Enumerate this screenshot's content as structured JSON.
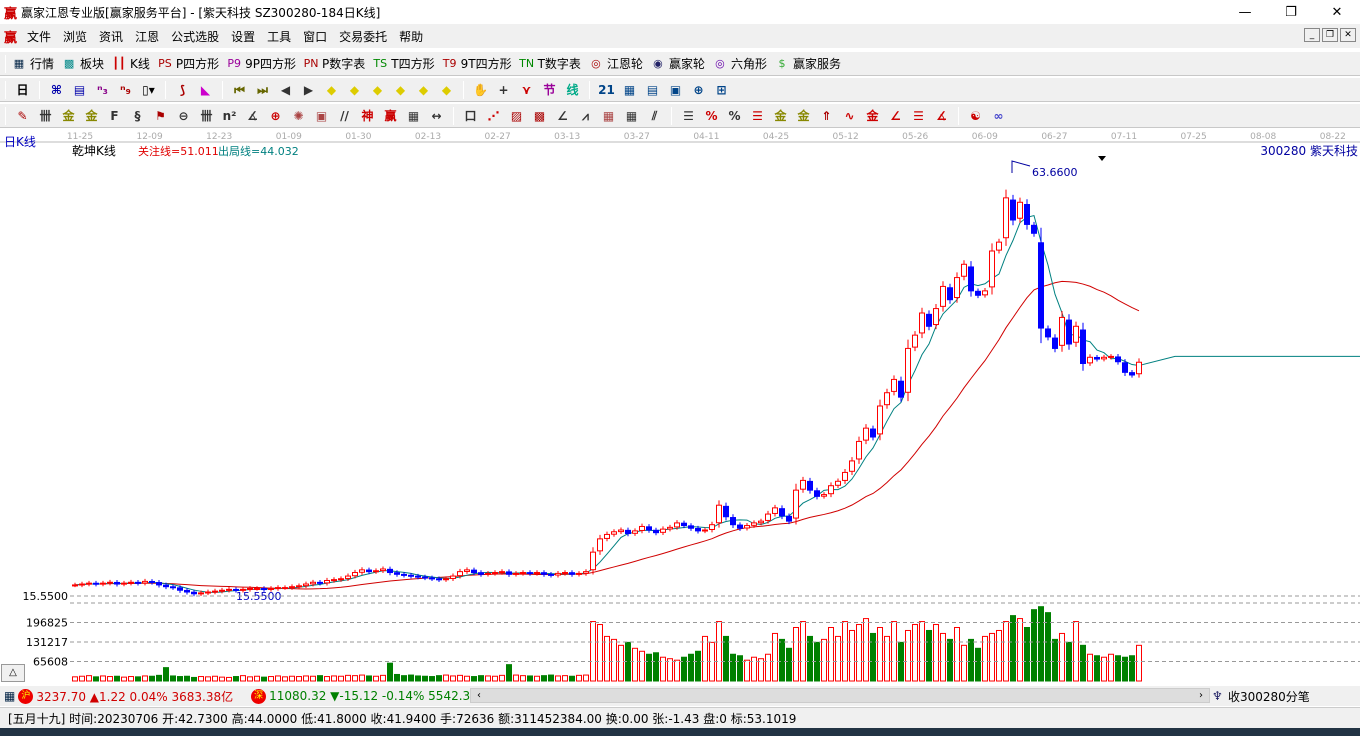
{
  "window": {
    "logo": "赢",
    "title": "赢家江恩专业版[赢家服务平台] - [紫天科技  SZ300280-184日K线]",
    "minimize": "—",
    "restore": "❐",
    "close": "✕"
  },
  "menu": {
    "logo": "赢",
    "items": [
      "文件",
      "浏览",
      "资讯",
      "江恩",
      "公式选股",
      "设置",
      "工具",
      "窗口",
      "交易委托",
      "帮助"
    ],
    "mdi": [
      "_",
      "❐",
      "✕"
    ]
  },
  "toolbar1": [
    {
      "icon": "quote-table-icon",
      "glyph": "▦",
      "label": "行情",
      "color": "#024"
    },
    {
      "icon": "sector-icon",
      "glyph": "▩",
      "label": "板块",
      "color": "#088"
    },
    {
      "icon": "kline-icon",
      "glyph": "┃┃",
      "label": "K线",
      "color": "#c00"
    },
    {
      "icon": "ps-icon",
      "glyph": "PS",
      "label": "P四方形",
      "color": "#a00"
    },
    {
      "icon": "p9-icon",
      "glyph": "P9",
      "label": "9P四方形",
      "color": "#909"
    },
    {
      "icon": "pn-icon",
      "glyph": "PN",
      "label": "P数字表",
      "color": "#a00"
    },
    {
      "icon": "ts-icon",
      "glyph": "TS",
      "label": "T四方形",
      "color": "#080"
    },
    {
      "icon": "t9-icon",
      "glyph": "T9",
      "label": "9T四方形",
      "color": "#a00"
    },
    {
      "icon": "tn-icon",
      "glyph": "TN",
      "label": "T数字表",
      "color": "#080"
    },
    {
      "icon": "gann-wheel-icon",
      "glyph": "◎",
      "label": "江恩轮",
      "color": "#a00"
    },
    {
      "icon": "big-wheel-icon",
      "glyph": "◉",
      "label": "赢家轮",
      "color": "#226"
    },
    {
      "icon": "hexagon-icon",
      "glyph": "◎",
      "label": "六角形",
      "color": "#60a"
    },
    {
      "icon": "dollar-icon",
      "glyph": "$",
      "label": "赢家服务",
      "color": "#3a3"
    }
  ],
  "toolbar2": [
    [
      "day-period-icon",
      "日▾",
      "#000"
    ],
    [
      "sep"
    ],
    [
      "chart-type-icon",
      "⌘",
      "#00a"
    ],
    [
      "notes-icon",
      "▤",
      "#00a"
    ],
    [
      "indicator3-icon",
      "ⁿ₃",
      "#808"
    ],
    [
      "indicator9-icon",
      "ⁿ₉",
      "#a00"
    ],
    [
      "candle-type-icon",
      "▯▾",
      "#000"
    ],
    [
      "sep"
    ],
    [
      "mix-icon",
      "⟆",
      "#a00"
    ],
    [
      "flag-icon",
      "◣",
      "#c0c"
    ],
    [
      "sep"
    ],
    [
      "first-icon",
      "⏮",
      "#660"
    ],
    [
      "last-icon",
      "⏭",
      "#660"
    ],
    [
      "prev-icon",
      "◀",
      "#333"
    ],
    [
      "next-icon",
      "▶",
      "#333"
    ],
    [
      "left-icon",
      "◆",
      "#dc0"
    ],
    [
      "right-icon",
      "◆",
      "#dc0"
    ],
    [
      "expand-icon",
      "◆",
      "#dc0"
    ],
    [
      "shrink-icon",
      "◆",
      "#dc0"
    ],
    [
      "zoom-in-icon",
      "◆",
      "#dc0"
    ],
    [
      "zoom-out-icon",
      "◆",
      "#dc0"
    ],
    [
      "sep"
    ],
    [
      "hand-icon",
      "✋",
      "#333"
    ],
    [
      "crosshair-icon",
      "+",
      "#333"
    ],
    [
      "line-icon",
      "⋎",
      "#c00"
    ],
    [
      "section-icon",
      "节",
      "#909"
    ],
    [
      "thread-icon",
      "线",
      "#0a8"
    ],
    [
      "sep"
    ],
    [
      "calendar-icon",
      "21",
      "#048"
    ],
    [
      "calculator-icon",
      "▦",
      "#048"
    ],
    [
      "report-icon",
      "▤",
      "#048"
    ],
    [
      "save-icon",
      "▣",
      "#048"
    ],
    [
      "network-icon",
      "⊕",
      "#048"
    ],
    [
      "connect-icon",
      "⊞",
      "#048"
    ]
  ],
  "toolbar3": [
    [
      "pen-icon",
      "✎",
      "#a00"
    ],
    [
      "grid-icon",
      "卌",
      "#333"
    ],
    [
      "gold1-icon",
      "金",
      "#880"
    ],
    [
      "gold2-icon",
      "金",
      "#880"
    ],
    [
      "f-icon",
      "F",
      "#333"
    ],
    [
      "spiral-icon",
      "§",
      "#333"
    ],
    [
      "fan-icon",
      "⚑",
      "#a00"
    ],
    [
      "circle-icon",
      "⊖",
      "#333"
    ],
    [
      "lines-icon",
      "卌",
      "#333"
    ],
    [
      "n2-icon",
      "n²",
      "#333"
    ],
    [
      "angle-icon",
      "∡",
      "#333"
    ],
    [
      "target-icon",
      "⊕",
      "#c00"
    ],
    [
      "radar-icon",
      "✺",
      "#a44"
    ],
    [
      "square-icon",
      "▣",
      "#a44"
    ],
    [
      "slash-icon",
      "//",
      "#333"
    ],
    [
      "shen-icon",
      "神",
      "#c00"
    ],
    [
      "ying-icon",
      "赢",
      "#c00"
    ],
    [
      "cal-icon",
      "▦",
      "#333"
    ],
    [
      "measure-icon",
      "↔",
      "#333"
    ],
    [
      "sep"
    ],
    [
      "box-icon",
      "口",
      "#333"
    ],
    [
      "fan-lines-icon",
      "⋰",
      "#c00"
    ],
    [
      "box-fan-icon",
      "▨",
      "#a00"
    ],
    [
      "box-fan2-icon",
      "▩",
      "#a00"
    ],
    [
      "angle2-icon",
      "∠",
      "#333"
    ],
    [
      "zigzag-icon",
      "⩘",
      "#333"
    ],
    [
      "grid2-icon",
      "▦",
      "#a44"
    ],
    [
      "grid3-icon",
      "▦",
      "#333"
    ],
    [
      "parallel-icon",
      "⫽",
      "#333"
    ],
    [
      "sep"
    ],
    [
      "ruler-icon",
      "☰",
      "#333"
    ],
    [
      "pct-line-icon",
      "%",
      "#c00"
    ],
    [
      "pct-icon",
      "%",
      "#333"
    ],
    [
      "pct-lines-icon",
      "☰",
      "#c00"
    ],
    [
      "gold-circle-icon",
      "金",
      "#880"
    ],
    [
      "gold-lines-icon",
      "金",
      "#880"
    ],
    [
      "arrow-icon",
      "⇑",
      "#a00"
    ],
    [
      "wave-icon",
      "∿",
      "#c00"
    ],
    [
      "gold-band-icon",
      "金",
      "#c00"
    ],
    [
      "angle3-icon",
      "∠",
      "#c00"
    ],
    [
      "lines3-icon",
      "☰",
      "#c00"
    ],
    [
      "angle4-icon",
      "∡",
      "#c00"
    ],
    [
      "sep"
    ],
    [
      "yin-yang-icon",
      "☯",
      "#c00"
    ],
    [
      "infinity-icon",
      "∞",
      "#44c"
    ]
  ],
  "chart": {
    "period_label": "日K线",
    "indicator_name": "乾坤K线",
    "focus_line": "关注线=51.011",
    "exit_line": "出局线=44.032",
    "stock": "300280  紫天科技",
    "high_label": "63.6600",
    "low_label": "15.5500",
    "min_marker": "15.5500",
    "dates": [
      "11-25",
      "12-09",
      "12-23",
      "01-09",
      "01-30",
      "02-13",
      "02-27",
      "03-13",
      "03-27",
      "04-11",
      "04-25",
      "05-12",
      "05-26",
      "06-09",
      "06-27",
      "07-11",
      "07-25",
      "08-08",
      "08-22"
    ],
    "vol_ticks": [
      "196825",
      "131217",
      "65608"
    ],
    "colors": {
      "up": "#ff0000",
      "down": "#0000ff",
      "ma_short": "#008080",
      "ma_long": "#d00000",
      "vol_down": "#008000",
      "grid": "#999999"
    },
    "closes": [
      16.8,
      16.9,
      17.0,
      16.9,
      17.0,
      17.1,
      16.9,
      17.0,
      17.1,
      17.0,
      17.2,
      17.1,
      16.8,
      16.6,
      16.5,
      16.2,
      16.0,
      15.8,
      15.9,
      16.0,
      16.1,
      16.2,
      16.3,
      16.2,
      16.3,
      16.4,
      16.4,
      16.3,
      16.4,
      16.5,
      16.5,
      16.6,
      16.7,
      16.9,
      17.1,
      17.0,
      17.3,
      17.4,
      17.5,
      17.8,
      18.2,
      18.5,
      18.3,
      18.4,
      18.6,
      18.2,
      18.0,
      17.9,
      17.8,
      17.7,
      17.6,
      17.5,
      17.4,
      17.5,
      17.8,
      18.3,
      18.5,
      18.2,
      18.0,
      18.1,
      18.2,
      18.3,
      18.0,
      18.1,
      18.2,
      18.1,
      18.2,
      18.0,
      17.9,
      18.1,
      18.2,
      18.0,
      18.1,
      18.3,
      20.5,
      22.0,
      22.5,
      22.8,
      23.0,
      22.6,
      22.9,
      23.4,
      23.0,
      22.7,
      23.1,
      23.3,
      23.8,
      23.5,
      23.2,
      22.9,
      23.0,
      23.6,
      25.8,
      24.5,
      23.6,
      23.2,
      23.5,
      23.8,
      24.0,
      24.8,
      25.5,
      24.6,
      24.0,
      27.5,
      28.6,
      27.5,
      26.8,
      27.0,
      28.0,
      28.5,
      29.5,
      30.8,
      33.0,
      34.5,
      33.5,
      37.0,
      38.5,
      40.0,
      38.0,
      43.5,
      45.0,
      47.5,
      46.0,
      48.0,
      50.5,
      49.0,
      51.5,
      53.0,
      50.0,
      49.5,
      50.0,
      54.5,
      55.5,
      60.5,
      58.0,
      60.0,
      57.5,
      56.5,
      45.8,
      44.8,
      43.5,
      47.0,
      44.0,
      46.0,
      41.8,
      42.5,
      42.3,
      42.5,
      42.6,
      42.0,
      40.8,
      40.5,
      41.94
    ],
    "volumes": [
      14000,
      16000,
      18000,
      14000,
      17000,
      15000,
      16000,
      13000,
      15000,
      14000,
      17000,
      16000,
      19000,
      45000,
      17000,
      15000,
      16000,
      12000,
      15000,
      14000,
      16000,
      13000,
      12000,
      15000,
      18000,
      14000,
      16000,
      13000,
      15000,
      17000,
      14000,
      16000,
      15000,
      17000,
      16000,
      18000,
      15000,
      17000,
      16000,
      19000,
      18000,
      20000,
      17000,
      16000,
      19000,
      60000,
      22000,
      18000,
      20000,
      17000,
      16000,
      15000,
      18000,
      20000,
      17000,
      19000,
      16000,
      15000,
      18000,
      17000,
      16000,
      19000,
      55000,
      20000,
      18000,
      17000,
      16000,
      18000,
      20000,
      17000,
      18000,
      16000,
      19000,
      20000,
      200000,
      190000,
      150000,
      140000,
      120000,
      130000,
      110000,
      100000,
      90000,
      95000,
      80000,
      75000,
      70000,
      80000,
      90000,
      100000,
      150000,
      130000,
      200000,
      150000,
      90000,
      85000,
      70000,
      80000,
      75000,
      90000,
      160000,
      140000,
      110000,
      180000,
      200000,
      150000,
      130000,
      140000,
      180000,
      150000,
      200000,
      170000,
      190000,
      210000,
      160000,
      180000,
      150000,
      200000,
      130000,
      170000,
      190000,
      200000,
      170000,
      190000,
      160000,
      140000,
      180000,
      120000,
      140000,
      110000,
      150000,
      160000,
      170000,
      200000,
      220000,
      210000,
      180000,
      240000,
      250000,
      230000,
      140000,
      160000,
      130000,
      200000,
      120000,
      90000,
      85000,
      80000,
      90000,
      85000,
      80000,
      85000,
      120000
    ]
  },
  "status": {
    "sh_badge": "沪",
    "sh": "3237.70 ▲1.22 0.04% 3683.38亿",
    "sz_badge": "深",
    "sz": "11080.32 ▼-15.12 -0.14% 5542.38",
    "scroll_left": "‹",
    "scroll_right": "›",
    "tick_label": "收300280分笔",
    "toggle": "△"
  },
  "info": "[五月十九] 时间:20230706 开:42.7300 高:44.0000 低:41.8000 收:41.9400 手:72636 额:311452384.00 换:0.00 张:-1.43 盘:0 标:53.1019"
}
